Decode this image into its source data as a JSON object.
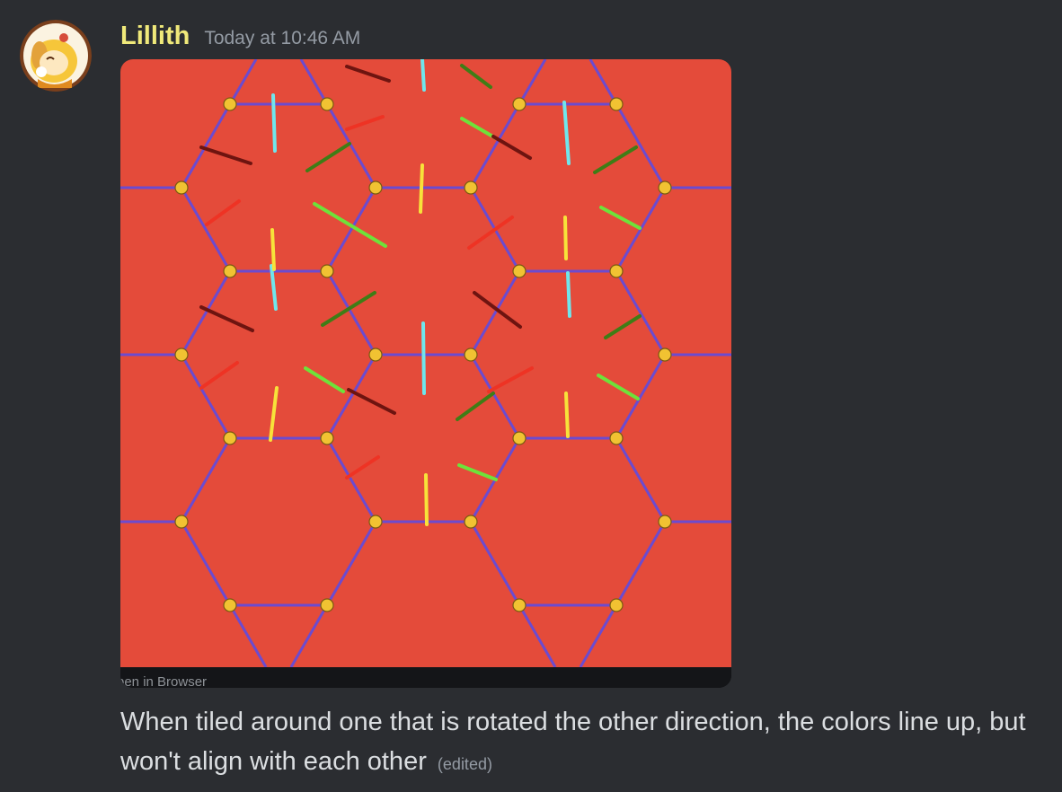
{
  "message": {
    "author": "Lillith",
    "timestamp": "Today at 10:46 AM",
    "avatar_icon": "avatar-character-icon",
    "text": "When tiled around one that is rotated the other direction, the colors line up, but won't align with each other",
    "edited_label": "(edited)",
    "author_color": "#f0e97a"
  },
  "attachment": {
    "open_in_browser_label": "pen in Browser",
    "background_color": "#e44b3a",
    "edge_color": "#6b4bd0",
    "vertex_color": "#f1c232"
  }
}
